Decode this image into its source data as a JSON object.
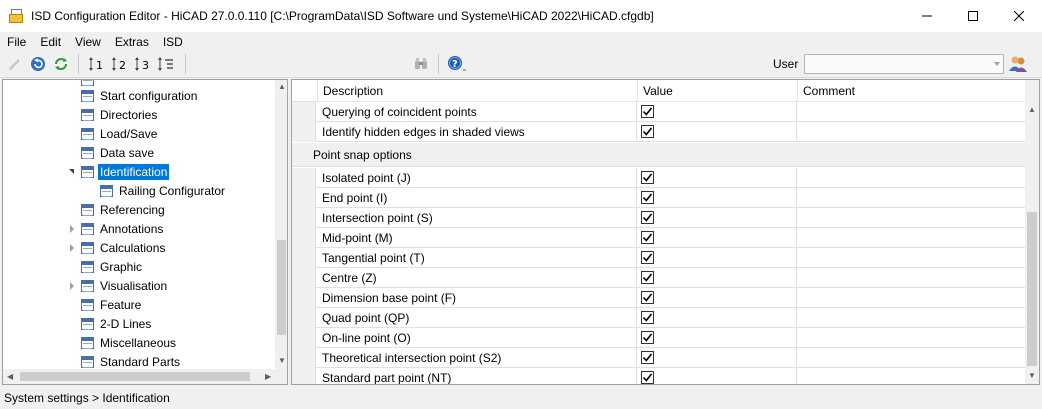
{
  "window": {
    "title": "ISD Configuration Editor - HiCAD 27.0.0.110 [C:\\ProgramData\\ISD Software und Systeme\\HiCAD 2022\\HiCAD.cfgdb]"
  },
  "menu": [
    "File",
    "Edit",
    "View",
    "Extras",
    "ISD"
  ],
  "toolbar": {
    "user_label": "User",
    "user_value": ""
  },
  "tree": {
    "items": [
      {
        "label": "Start configuration",
        "level": 0,
        "expander": "none",
        "selected": false
      },
      {
        "label": "Directories",
        "level": 0,
        "expander": "none",
        "selected": false
      },
      {
        "label": "Load/Save",
        "level": 0,
        "expander": "none",
        "selected": false
      },
      {
        "label": "Data save",
        "level": 0,
        "expander": "none",
        "selected": false
      },
      {
        "label": "Identification",
        "level": 0,
        "expander": "expanded",
        "selected": true
      },
      {
        "label": "Railing Configurator",
        "level": 1,
        "expander": "none",
        "selected": false
      },
      {
        "label": "Referencing",
        "level": 0,
        "expander": "none",
        "selected": false
      },
      {
        "label": "Annotations",
        "level": 0,
        "expander": "collapsed",
        "selected": false
      },
      {
        "label": "Calculations",
        "level": 0,
        "expander": "collapsed",
        "selected": false
      },
      {
        "label": "Graphic",
        "level": 0,
        "expander": "none",
        "selected": false
      },
      {
        "label": "Visualisation",
        "level": 0,
        "expander": "collapsed",
        "selected": false
      },
      {
        "label": "Feature",
        "level": 0,
        "expander": "none",
        "selected": false
      },
      {
        "label": "2-D Lines",
        "level": 0,
        "expander": "none",
        "selected": false
      },
      {
        "label": "Miscellaneous",
        "level": 0,
        "expander": "none",
        "selected": false
      },
      {
        "label": "Standard Parts",
        "level": 0,
        "expander": "none",
        "selected": false
      }
    ]
  },
  "grid": {
    "columns": {
      "description": "Description",
      "value": "Value",
      "comment": "Comment"
    },
    "rows_top": [
      {
        "description": "Querying of coincident points",
        "checked": true,
        "comment": ""
      },
      {
        "description": "Identify hidden edges in shaded views",
        "checked": true,
        "comment": ""
      }
    ],
    "group": {
      "label": "Point snap options"
    },
    "rows": [
      {
        "description": "Isolated point (J)",
        "checked": true,
        "comment": ""
      },
      {
        "description": "End point (I)",
        "checked": true,
        "comment": ""
      },
      {
        "description": "Intersection point (S)",
        "checked": true,
        "comment": ""
      },
      {
        "description": "Mid-point (M)",
        "checked": true,
        "comment": ""
      },
      {
        "description": "Tangential point (T)",
        "checked": true,
        "comment": ""
      },
      {
        "description": "Centre (Z)",
        "checked": true,
        "comment": ""
      },
      {
        "description": "Dimension base point (F)",
        "checked": true,
        "comment": ""
      },
      {
        "description": "Quad point (QP)",
        "checked": true,
        "comment": ""
      },
      {
        "description": "On-line point (O)",
        "checked": true,
        "comment": ""
      },
      {
        "description": "Theoretical intersection point (S2)",
        "checked": true,
        "comment": ""
      },
      {
        "description": "Standard part point (NT)",
        "checked": true,
        "comment": ""
      }
    ]
  },
  "status": {
    "text": "System settings > Identification"
  }
}
